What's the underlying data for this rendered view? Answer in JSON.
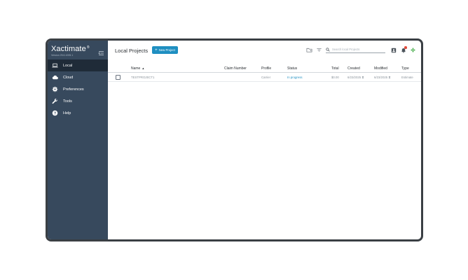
{
  "app": {
    "name": "Xactimate",
    "trademark": "®",
    "version": "Version 25.6.1005.1"
  },
  "sidebar": {
    "items": [
      {
        "label": "Local",
        "icon": "laptop-icon",
        "active": true
      },
      {
        "label": "Cloud",
        "icon": "cloud-icon",
        "active": false
      },
      {
        "label": "Preferences",
        "icon": "gear-icon",
        "active": false
      },
      {
        "label": "Tools",
        "icon": "wrench-icon",
        "active": false
      },
      {
        "label": "Help",
        "icon": "help-circle-icon",
        "active": false
      }
    ]
  },
  "header": {
    "title": "Local Projects",
    "new_project_label": "New Project",
    "search_placeholder": "Search local Projects"
  },
  "table": {
    "columns": [
      "Name",
      "Claim Number",
      "Profile",
      "Status",
      "Total",
      "Created",
      "Modified",
      "Type"
    ],
    "rows": [
      {
        "name": "TESTPROJECT1",
        "claim_number": "",
        "profile": "Carrier",
        "status": "In progress",
        "total": "$0.00",
        "created": "6/23/2025",
        "modified": "6/23/2025",
        "type": "Estimate"
      }
    ]
  },
  "colors": {
    "sidebar": "#37495d",
    "sidebar_active": "#1f2b38",
    "accent": "#1f8fc1",
    "notification": "#e24a3b",
    "sync_icon": "#4cb050"
  }
}
